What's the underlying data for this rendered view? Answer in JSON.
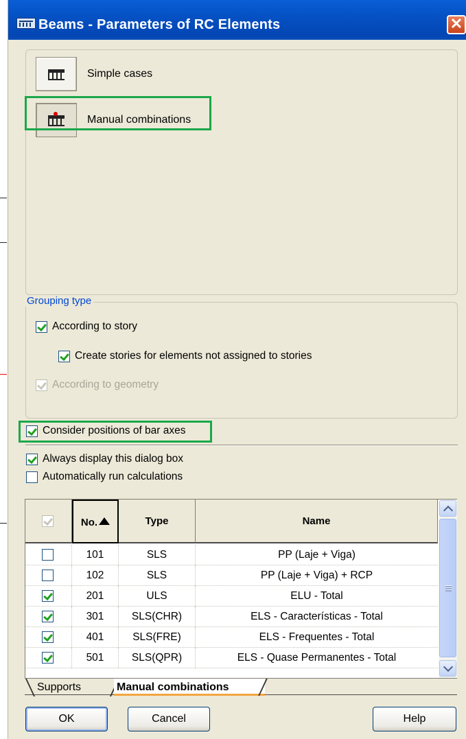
{
  "window": {
    "title": "Beams - Parameters of RC Elements",
    "close_glyph": "✕"
  },
  "mode_buttons": [
    {
      "label": "Simple cases",
      "icon": "beam-simple-icon"
    },
    {
      "label": "Manual combinations",
      "icon": "beam-combination-icon"
    }
  ],
  "grouping": {
    "legend": "Grouping type",
    "according_to_story": {
      "label": "According to story",
      "checked": true
    },
    "create_stories": {
      "label": "Create stories for elements not assigned to stories",
      "checked": true
    },
    "according_to_geometry": {
      "label": "According to geometry",
      "checked": true,
      "disabled": true
    }
  },
  "options": {
    "consider_bar_axes": {
      "label": "Consider positions of bar axes",
      "checked": true
    },
    "always_display": {
      "label": "Always display this dialog box",
      "checked": true
    },
    "auto_run": {
      "label": "Automatically run calculations",
      "checked": false
    }
  },
  "table": {
    "columns": [
      "No.",
      "Type",
      "Name"
    ],
    "header_checkbox_checked": true,
    "rows": [
      {
        "checked": false,
        "no": "101",
        "type": "SLS",
        "name": "PP (Laje + Viga)"
      },
      {
        "checked": false,
        "no": "102",
        "type": "SLS",
        "name": "PP (Laje + Viga) + RCP"
      },
      {
        "checked": true,
        "no": "201",
        "type": "ULS",
        "name": "ELU - Total"
      },
      {
        "checked": true,
        "no": "301",
        "type": "SLS(CHR)",
        "name": "ELS - Características - Total"
      },
      {
        "checked": true,
        "no": "401",
        "type": "SLS(FRE)",
        "name": "ELS - Frequentes - Total"
      },
      {
        "checked": true,
        "no": "501",
        "type": "SLS(QPR)",
        "name": "ELS - Quase Permanentes - Total"
      }
    ]
  },
  "tabs": [
    {
      "label": "Supports",
      "active": false
    },
    {
      "label": "Manual combinations",
      "active": true
    }
  ],
  "footer": {
    "ok": "OK",
    "cancel": "Cancel",
    "help": "Help"
  },
  "colors": {
    "highlight": "#1aa84a",
    "titlebar": "#0551c4",
    "face": "#ECE9D8"
  }
}
